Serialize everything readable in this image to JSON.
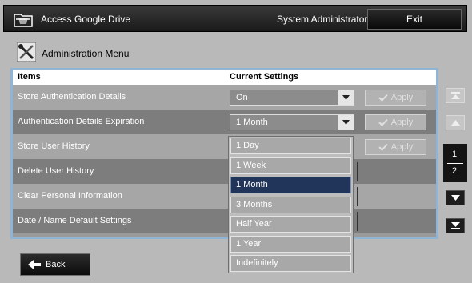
{
  "header": {
    "app_title": "Access Google Drive",
    "user": "System Administrator",
    "exit_label": "Exit",
    "app_icon": "drive-folder-icon"
  },
  "menu": {
    "title": "Administration Menu",
    "icon": "tools-icon"
  },
  "table": {
    "col_items": "Items",
    "col_current": "Current Settings",
    "rows": [
      {
        "label": "Store Authentication Details",
        "value": "On",
        "apply": "Apply"
      },
      {
        "label": "Authentication Details Expiration",
        "value": "1 Month",
        "apply": "Apply"
      },
      {
        "label": "Store User History",
        "apply": "Apply"
      },
      {
        "label": "Delete User History"
      },
      {
        "label": "Clear Personal Information"
      },
      {
        "label": "Date / Name Default Settings"
      }
    ]
  },
  "dropdown": {
    "options": [
      "1 Day",
      "1 Week",
      "1 Month",
      "3 Months",
      "Half Year",
      "1 Year",
      "Indefinitely"
    ],
    "selected": "1 Month"
  },
  "pager": {
    "current": "1",
    "total": "2"
  },
  "back_label": "Back",
  "colors": {
    "table_border": "#8fb5d6",
    "selected_option": "#203559",
    "topbar": "#1a1a1a"
  }
}
